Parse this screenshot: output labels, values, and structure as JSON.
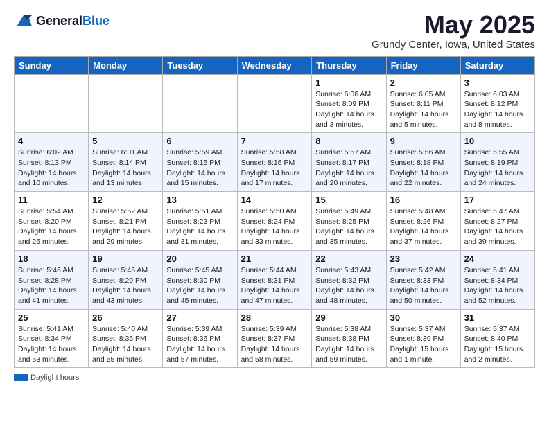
{
  "logo": {
    "text_general": "General",
    "text_blue": "Blue"
  },
  "title": {
    "month": "May 2025",
    "location": "Grundy Center, Iowa, United States"
  },
  "weekdays": [
    "Sunday",
    "Monday",
    "Tuesday",
    "Wednesday",
    "Thursday",
    "Friday",
    "Saturday"
  ],
  "legend": {
    "label": "Daylight hours"
  },
  "weeks": [
    [
      {
        "day": "",
        "info": ""
      },
      {
        "day": "",
        "info": ""
      },
      {
        "day": "",
        "info": ""
      },
      {
        "day": "",
        "info": ""
      },
      {
        "day": "1",
        "info": "Sunrise: 6:06 AM\nSunset: 8:09 PM\nDaylight: 14 hours\nand 3 minutes."
      },
      {
        "day": "2",
        "info": "Sunrise: 6:05 AM\nSunset: 8:11 PM\nDaylight: 14 hours\nand 5 minutes."
      },
      {
        "day": "3",
        "info": "Sunrise: 6:03 AM\nSunset: 8:12 PM\nDaylight: 14 hours\nand 8 minutes."
      }
    ],
    [
      {
        "day": "4",
        "info": "Sunrise: 6:02 AM\nSunset: 8:13 PM\nDaylight: 14 hours\nand 10 minutes."
      },
      {
        "day": "5",
        "info": "Sunrise: 6:01 AM\nSunset: 8:14 PM\nDaylight: 14 hours\nand 13 minutes."
      },
      {
        "day": "6",
        "info": "Sunrise: 5:59 AM\nSunset: 8:15 PM\nDaylight: 14 hours\nand 15 minutes."
      },
      {
        "day": "7",
        "info": "Sunrise: 5:58 AM\nSunset: 8:16 PM\nDaylight: 14 hours\nand 17 minutes."
      },
      {
        "day": "8",
        "info": "Sunrise: 5:57 AM\nSunset: 8:17 PM\nDaylight: 14 hours\nand 20 minutes."
      },
      {
        "day": "9",
        "info": "Sunrise: 5:56 AM\nSunset: 8:18 PM\nDaylight: 14 hours\nand 22 minutes."
      },
      {
        "day": "10",
        "info": "Sunrise: 5:55 AM\nSunset: 8:19 PM\nDaylight: 14 hours\nand 24 minutes."
      }
    ],
    [
      {
        "day": "11",
        "info": "Sunrise: 5:54 AM\nSunset: 8:20 PM\nDaylight: 14 hours\nand 26 minutes."
      },
      {
        "day": "12",
        "info": "Sunrise: 5:52 AM\nSunset: 8:21 PM\nDaylight: 14 hours\nand 29 minutes."
      },
      {
        "day": "13",
        "info": "Sunrise: 5:51 AM\nSunset: 8:23 PM\nDaylight: 14 hours\nand 31 minutes."
      },
      {
        "day": "14",
        "info": "Sunrise: 5:50 AM\nSunset: 8:24 PM\nDaylight: 14 hours\nand 33 minutes."
      },
      {
        "day": "15",
        "info": "Sunrise: 5:49 AM\nSunset: 8:25 PM\nDaylight: 14 hours\nand 35 minutes."
      },
      {
        "day": "16",
        "info": "Sunrise: 5:48 AM\nSunset: 8:26 PM\nDaylight: 14 hours\nand 37 minutes."
      },
      {
        "day": "17",
        "info": "Sunrise: 5:47 AM\nSunset: 8:27 PM\nDaylight: 14 hours\nand 39 minutes."
      }
    ],
    [
      {
        "day": "18",
        "info": "Sunrise: 5:46 AM\nSunset: 8:28 PM\nDaylight: 14 hours\nand 41 minutes."
      },
      {
        "day": "19",
        "info": "Sunrise: 5:45 AM\nSunset: 8:29 PM\nDaylight: 14 hours\nand 43 minutes."
      },
      {
        "day": "20",
        "info": "Sunrise: 5:45 AM\nSunset: 8:30 PM\nDaylight: 14 hours\nand 45 minutes."
      },
      {
        "day": "21",
        "info": "Sunrise: 5:44 AM\nSunset: 8:31 PM\nDaylight: 14 hours\nand 47 minutes."
      },
      {
        "day": "22",
        "info": "Sunrise: 5:43 AM\nSunset: 8:32 PM\nDaylight: 14 hours\nand 48 minutes."
      },
      {
        "day": "23",
        "info": "Sunrise: 5:42 AM\nSunset: 8:33 PM\nDaylight: 14 hours\nand 50 minutes."
      },
      {
        "day": "24",
        "info": "Sunrise: 5:41 AM\nSunset: 8:34 PM\nDaylight: 14 hours\nand 52 minutes."
      }
    ],
    [
      {
        "day": "25",
        "info": "Sunrise: 5:41 AM\nSunset: 8:34 PM\nDaylight: 14 hours\nand 53 minutes."
      },
      {
        "day": "26",
        "info": "Sunrise: 5:40 AM\nSunset: 8:35 PM\nDaylight: 14 hours\nand 55 minutes."
      },
      {
        "day": "27",
        "info": "Sunrise: 5:39 AM\nSunset: 8:36 PM\nDaylight: 14 hours\nand 57 minutes."
      },
      {
        "day": "28",
        "info": "Sunrise: 5:39 AM\nSunset: 8:37 PM\nDaylight: 14 hours\nand 58 minutes."
      },
      {
        "day": "29",
        "info": "Sunrise: 5:38 AM\nSunset: 8:38 PM\nDaylight: 14 hours\nand 59 minutes."
      },
      {
        "day": "30",
        "info": "Sunrise: 5:37 AM\nSunset: 8:39 PM\nDaylight: 15 hours\nand 1 minute."
      },
      {
        "day": "31",
        "info": "Sunrise: 5:37 AM\nSunset: 8:40 PM\nDaylight: 15 hours\nand 2 minutes."
      }
    ]
  ]
}
